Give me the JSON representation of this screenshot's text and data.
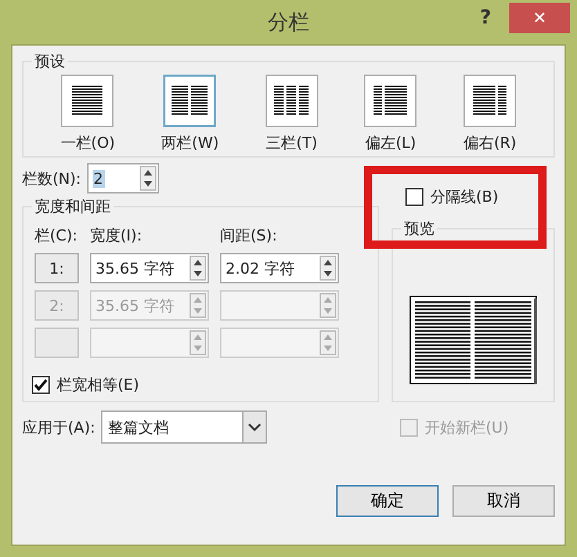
{
  "window": {
    "title": "分栏",
    "help": "?",
    "close": "✕"
  },
  "presets": {
    "title": "预设",
    "items": [
      {
        "kind": "one",
        "label": "一栏(O)",
        "selected": false
      },
      {
        "kind": "two",
        "label": "两栏(W)",
        "selected": true
      },
      {
        "kind": "three",
        "label": "三栏(T)",
        "selected": false
      },
      {
        "kind": "left",
        "label": "偏左(L)",
        "selected": false
      },
      {
        "kind": "right",
        "label": "偏右(R)",
        "selected": false
      }
    ]
  },
  "column_count": {
    "label": "栏数(N):",
    "value": "2"
  },
  "separator": {
    "label": "分隔线(B)",
    "checked": false
  },
  "width_spacing": {
    "title": "宽度和间距",
    "columns": [
      "栏(C):",
      "宽度(I):",
      "间距(S):"
    ],
    "rows": [
      {
        "number": "1:",
        "width": "35.65 字符",
        "spacing": "2.02 字符",
        "disabled": false
      },
      {
        "number": "2:",
        "width": "35.65 字符",
        "disabled": true
      },
      {
        "disabled": true
      }
    ],
    "equal_width": {
      "label": "栏宽相等(E)",
      "checked": true
    }
  },
  "preview": {
    "title": "预览"
  },
  "apply_to": {
    "label": "应用于(A):",
    "value": "整篇文档"
  },
  "start_new_column": {
    "label": "开始新栏(U)",
    "checked": false,
    "disabled": true
  },
  "buttons": [
    "确定",
    "取消"
  ]
}
